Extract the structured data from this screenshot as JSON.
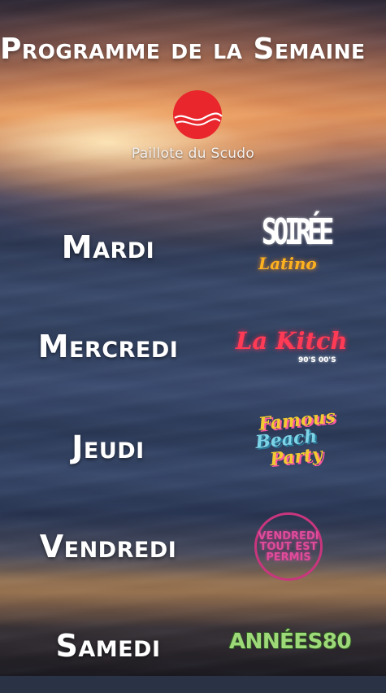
{
  "header": {
    "title": "Programme de la Semaine",
    "brand": "Paillote du Scudo"
  },
  "schedule": [
    {
      "day": "Mardi",
      "event": {
        "line1": "SOIRÉE",
        "line2": "Latino"
      }
    },
    {
      "day": "Mercredi",
      "event": {
        "line1": "La Kitch",
        "line2": "90'S 00'S"
      }
    },
    {
      "day": "Jeudi",
      "event": {
        "line1": "Famous",
        "line2": "Beach",
        "line3": "Party"
      }
    },
    {
      "day": "Vendredi",
      "event": {
        "line1": "VENDREDI",
        "line2": "TOUT EST",
        "line3": "PERMIS"
      }
    },
    {
      "day": "Samedi",
      "event": {
        "line1": "ANNÉES80"
      }
    }
  ],
  "colors": {
    "logo": "#e8262c",
    "latino": "#ffb21f",
    "kitch": "#ff3b55",
    "famous": "#f3c933",
    "badge": "#c8367e",
    "annees": "#9ed979"
  }
}
